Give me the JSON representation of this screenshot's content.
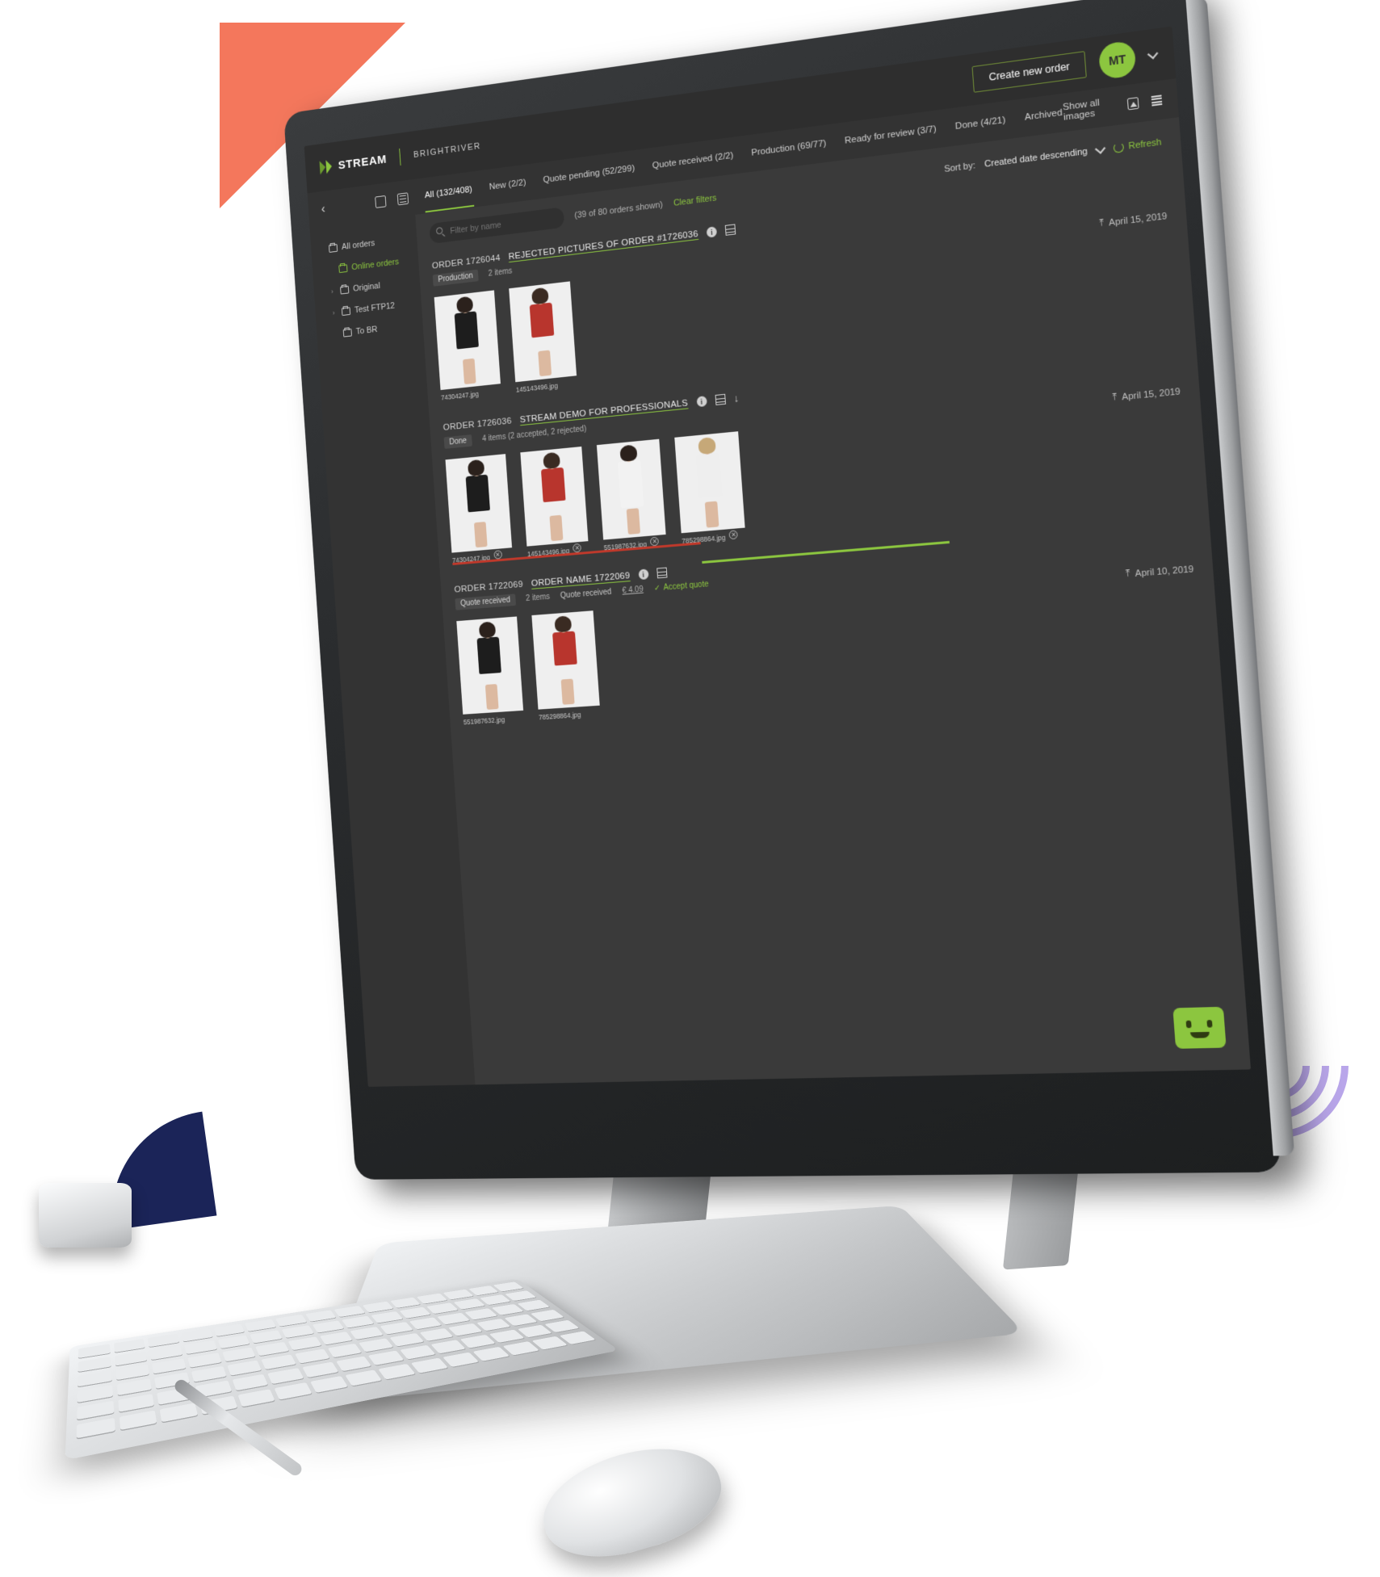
{
  "app": {
    "logo_word": "STREAM",
    "logo_sub": "BRIGHTRIVER"
  },
  "topbar": {
    "create_order_label": "Create new order",
    "avatar_initials": "MT",
    "chevron": "chevron-down"
  },
  "nav": {
    "back": "‹",
    "tabs": [
      {
        "label": "All (132/408)",
        "active": true
      },
      {
        "label": "New (2/2)",
        "active": false
      },
      {
        "label": "Quote pending (52/299)",
        "active": false
      },
      {
        "label": "Quote received (2/2)",
        "active": false
      },
      {
        "label": "Production (69/77)",
        "active": false
      },
      {
        "label": "Ready for review (3/7)",
        "active": false
      },
      {
        "label": "Done (4/21)",
        "active": false
      },
      {
        "label": "Archived",
        "active": false
      }
    ],
    "show_all_images": "Show all images"
  },
  "sidebar": {
    "items": [
      {
        "label": "All orders",
        "active": false,
        "indent": false,
        "caret": ""
      },
      {
        "label": "Online orders",
        "active": true,
        "indent": true,
        "caret": ""
      },
      {
        "label": "Original",
        "active": false,
        "indent": true,
        "caret": "›"
      },
      {
        "label": "Test FTP12",
        "active": false,
        "indent": true,
        "caret": "›"
      },
      {
        "label": "To BR",
        "active": false,
        "indent": true,
        "caret": ""
      }
    ]
  },
  "filterbar": {
    "search_placeholder": "Filter by name",
    "search_value": "",
    "count_text": "(39 of 80 orders shown)",
    "clear_filters": "Clear filters",
    "sort_label": "Sort by:",
    "sort_value": "Created date descending",
    "refresh_label": "Refresh"
  },
  "orders": [
    {
      "id_label": "ORDER 1726044",
      "name": "REJECTED PICTURES OF ORDER #1726036",
      "status": "Production",
      "items_text": "2 items",
      "date": "April 15, 2019",
      "has_download": false,
      "quote_text": "",
      "quote_amount": "",
      "accept_label": "",
      "thumbs": [
        {
          "file": "74304247.jpg",
          "rejected": false
        },
        {
          "file": "145143496.jpg",
          "rejected": false
        }
      ]
    },
    {
      "id_label": "ORDER 1726036",
      "name": "STREAM DEMO FOR PROFESSIONALS",
      "status": "Done",
      "items_text": "4 items (2 accepted, 2 rejected)",
      "date": "April 15, 2019",
      "has_download": true,
      "quote_text": "",
      "quote_amount": "",
      "accept_label": "",
      "thumbs": [
        {
          "file": "74304247.jpg",
          "rejected": true
        },
        {
          "file": "145143496.jpg",
          "rejected": true
        },
        {
          "file": "551987632.jpg",
          "rejected": true
        },
        {
          "file": "785298864.jpg",
          "rejected": true
        }
      ]
    },
    {
      "id_label": "ORDER 1722069",
      "name": "ORDER NAME 1722069",
      "status": "Quote received",
      "items_text": "2 items",
      "date": "April 10, 2019",
      "has_download": false,
      "quote_text": "Quote received",
      "quote_amount": "€ 4.09",
      "accept_label": "Accept quote",
      "thumbs": [
        {
          "file": "551987632.jpg",
          "rejected": false
        },
        {
          "file": "785298864.jpg",
          "rejected": false
        }
      ]
    }
  ],
  "colors": {
    "accent_green": "#8cc63f",
    "reject_red": "#c0392b",
    "screen_bg": "#3a3a3a",
    "panel_bg": "#333333",
    "coral": "#f4775c",
    "navy": "#1b2458",
    "lilac": "#b9a6ea"
  }
}
